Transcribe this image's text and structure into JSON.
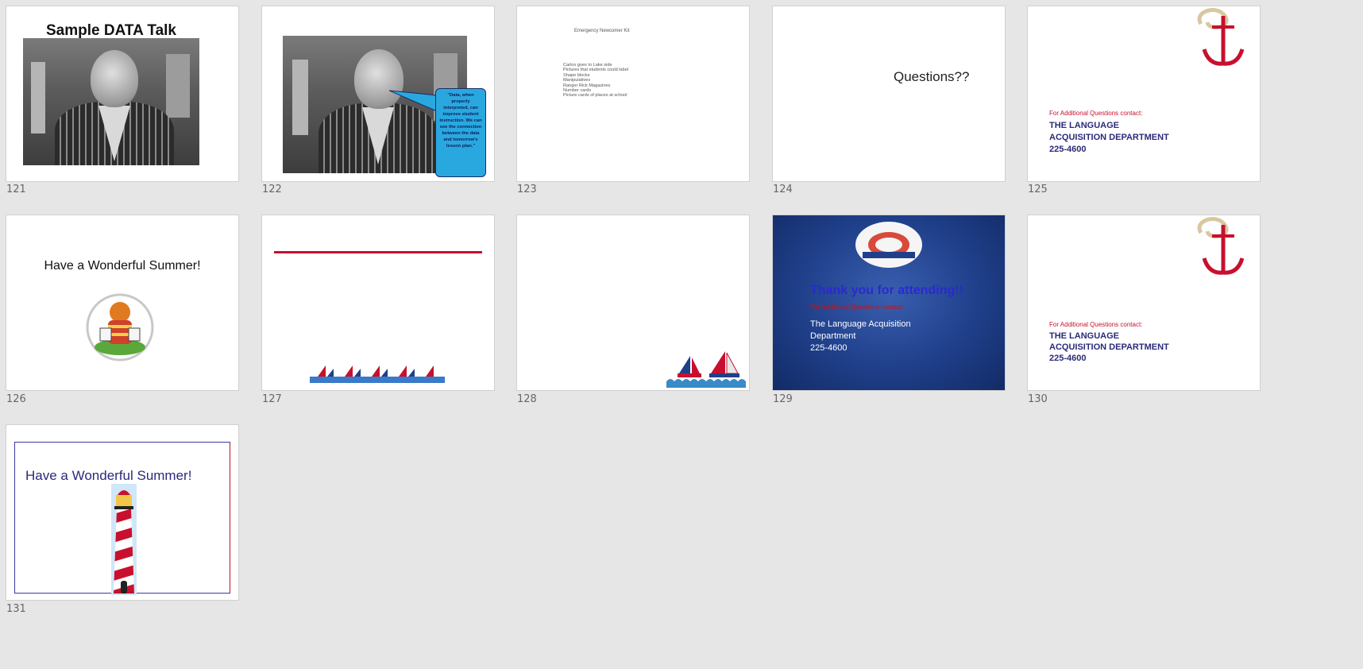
{
  "slides": [
    {
      "number": "121",
      "title": "Sample DATA Talk"
    },
    {
      "number": "122",
      "bubble": "\"Data, when properly interpreted, can improve student instruction. We can see the connection between the data and tomorrow's lesson plan.\""
    },
    {
      "number": "123",
      "heading": "Emergency Newcomer Kit",
      "items": [
        "Carlos goes to Lake side",
        "Pictures that students could label",
        "Shape blocks",
        "Manipulatives",
        "Ranger Rick Magazines",
        "Number cards",
        "Picture cards of places at school"
      ]
    },
    {
      "number": "124",
      "text": "Questions??"
    },
    {
      "number": "125",
      "contact_label": "For Additional Questions contact:",
      "dept_line1": "THE LANGUAGE",
      "dept_line2": "ACQUISITION DEPARTMENT",
      "phone": "225-4600"
    },
    {
      "number": "126",
      "title": "Have a Wonderful Summer!"
    },
    {
      "number": "127"
    },
    {
      "number": "128"
    },
    {
      "number": "129",
      "title": "Thank you for attending!!",
      "contact_label": "For Additional Questions contact:",
      "dept_line1": "The Language Acquisition",
      "dept_line2": "Department",
      "phone": "225-4600"
    },
    {
      "number": "130",
      "contact_label": "For Additional Questions contact:",
      "dept_line1": "THE LANGUAGE",
      "dept_line2": "ACQUISITION DEPARTMENT",
      "phone": "225-4600"
    },
    {
      "number": "131",
      "title": "Have a Wonderful Summer!"
    }
  ],
  "colors": {
    "background": "#e6e6e6",
    "accent_red": "#c8102e",
    "navy": "#2a2a7a",
    "bubble": "#29a8e0",
    "slide129_bg": "#1f3f8a"
  }
}
